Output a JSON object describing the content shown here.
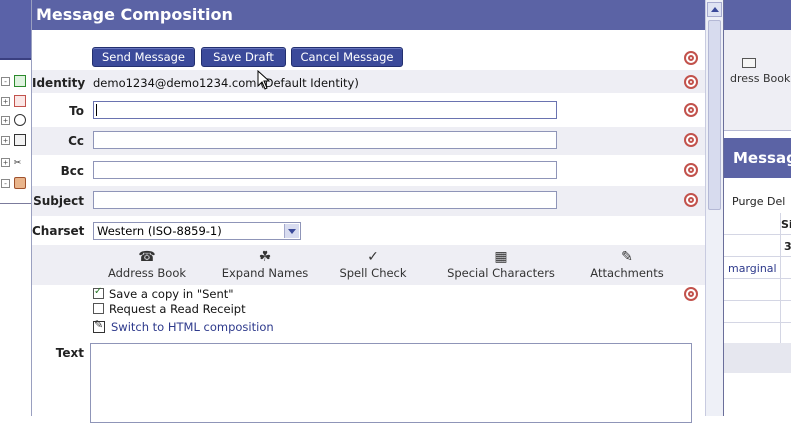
{
  "dialog": {
    "title": "Message Composition"
  },
  "toolbar": {
    "send_label": "Send Message",
    "save_label": "Save Draft",
    "cancel_label": "Cancel Message"
  },
  "fields": {
    "identity_label": "Identity",
    "identity_value": "demo1234@demo1234.com (Default Identity)",
    "to_label": "To",
    "to_value": "",
    "cc_label": "Cc",
    "cc_value": "",
    "bcc_label": "Bcc",
    "bcc_value": "",
    "subject_label": "Subject",
    "subject_value": "",
    "charset_label": "Charset",
    "charset_value": "Western (ISO-8859-1)",
    "text_label": "Text"
  },
  "tools": [
    {
      "label": "Address Book",
      "icon": "address-book-icon"
    },
    {
      "label": "Expand Names",
      "icon": "expand-names-icon"
    },
    {
      "label": "Spell Check",
      "icon": "spell-check-icon"
    },
    {
      "label": "Special Characters",
      "icon": "special-characters-icon"
    },
    {
      "label": "Attachments",
      "icon": "paperclip-icon"
    }
  ],
  "options": {
    "save_copy_label": "Save a copy in \"Sent\"",
    "save_copy_checked": true,
    "read_receipt_label": "Request a Read Receipt",
    "read_receipt_checked": false,
    "switch_html_label": "Switch to HTML composition"
  },
  "right_panel": {
    "address_book_label": "dress Book",
    "messages_title": "Messag",
    "purge_label": "Purge Del",
    "col_header": "Si",
    "count": "3",
    "row_label": "marginal"
  },
  "colors": {
    "title_bar": "#5b63a5",
    "button": "#3b4a9a",
    "help_icon": "#c2524c",
    "link": "#2e3a8c"
  }
}
